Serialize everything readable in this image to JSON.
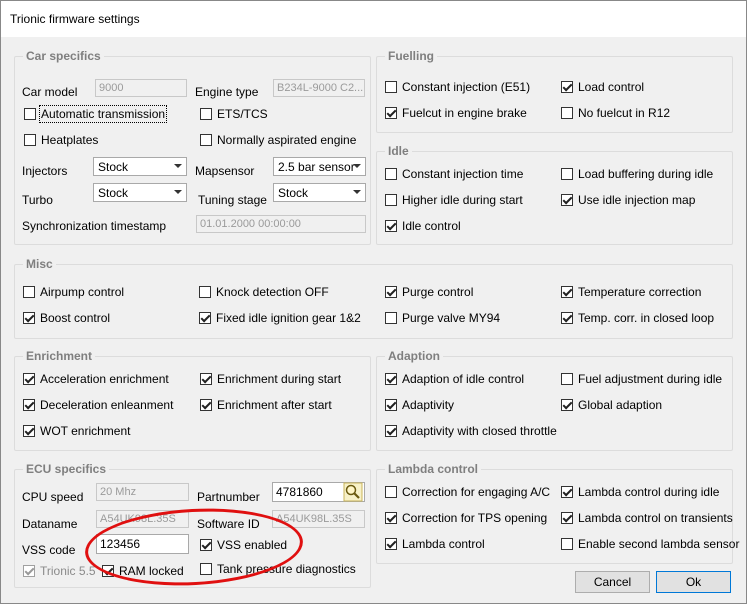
{
  "window": {
    "title": "Trionic firmware settings"
  },
  "car_specifics": {
    "legend": "Car specifics",
    "car_model_label": "Car model",
    "car_model_value": "9000",
    "engine_type_label": "Engine type",
    "engine_type_value": "B234L-9000 C2...",
    "automatic_transmission": {
      "label": "Automatic transmission",
      "checked": false
    },
    "ets_tcs": {
      "label": "ETS/TCS",
      "checked": false
    },
    "heatplates": {
      "label": "Heatplates",
      "checked": false
    },
    "normally_aspirated": {
      "label": "Normally aspirated engine",
      "checked": false
    },
    "injectors_label": "Injectors",
    "injectors_value": "Stock",
    "mapsensor_label": "Mapsensor",
    "mapsensor_value": "2.5 bar sensor",
    "turbo_label": "Turbo",
    "turbo_value": "Stock",
    "tuning_stage_label": "Tuning stage",
    "tuning_stage_value": "Stock",
    "sync_label": "Synchronization timestamp",
    "sync_value": "01.01.2000 00:00:00"
  },
  "fuelling": {
    "legend": "Fuelling",
    "constant_injection": {
      "label": "Constant injection (E51)",
      "checked": false
    },
    "load_control": {
      "label": "Load control",
      "checked": true
    },
    "fuelcut_engine_brake": {
      "label": "Fuelcut in engine brake",
      "checked": true
    },
    "no_fuelcut_r12": {
      "label": "No fuelcut in R12",
      "checked": false
    }
  },
  "idle": {
    "legend": "Idle",
    "constant_injection_time": {
      "label": "Constant injection time",
      "checked": false
    },
    "load_buffering_idle": {
      "label": "Load buffering during idle",
      "checked": false
    },
    "higher_idle_start": {
      "label": "Higher idle during start",
      "checked": false
    },
    "use_idle_injection_map": {
      "label": "Use idle injection map",
      "checked": true
    },
    "idle_control": {
      "label": "Idle control",
      "checked": true
    }
  },
  "misc": {
    "legend": "Misc",
    "airpump_control": {
      "label": "Airpump control",
      "checked": false
    },
    "knock_detection_off": {
      "label": "Knock detection OFF",
      "checked": false
    },
    "purge_control": {
      "label": "Purge control",
      "checked": true
    },
    "temperature_correction": {
      "label": "Temperature correction",
      "checked": true
    },
    "boost_control": {
      "label": "Boost control",
      "checked": true
    },
    "fixed_idle_ignition": {
      "label": "Fixed idle ignition gear 1&2",
      "checked": true
    },
    "purge_valve_my94": {
      "label": "Purge valve MY94",
      "checked": false
    },
    "temp_corr_closed_loop": {
      "label": "Temp. corr. in closed loop",
      "checked": true
    }
  },
  "enrichment": {
    "legend": "Enrichment",
    "acceleration_enrichment": {
      "label": "Acceleration enrichment",
      "checked": true
    },
    "enrichment_during_start": {
      "label": "Enrichment during start",
      "checked": true
    },
    "deceleration_enleanment": {
      "label": "Deceleration enleanment",
      "checked": true
    },
    "enrichment_after_start": {
      "label": "Enrichment after start",
      "checked": true
    },
    "wot_enrichment": {
      "label": "WOT enrichment",
      "checked": true
    }
  },
  "adaption": {
    "legend": "Adaption",
    "adaption_idle_control": {
      "label": "Adaption of idle control",
      "checked": true
    },
    "fuel_adjustment_idle": {
      "label": "Fuel adjustment during idle",
      "checked": false
    },
    "adaptivity": {
      "label": "Adaptivity",
      "checked": true
    },
    "global_adaption": {
      "label": "Global adaption",
      "checked": true
    },
    "adaptivity_closed_throttle": {
      "label": "Adaptivity with closed throttle",
      "checked": true
    }
  },
  "ecu_specifics": {
    "legend": "ECU specifics",
    "cpu_speed_label": "CPU speed",
    "cpu_speed_value": "20 Mhz",
    "partnumber_label": "Partnumber",
    "partnumber_value": "4781860",
    "dataname_label": "Dataname",
    "dataname_value": "A54UK98L.35S",
    "software_id_label": "Software ID",
    "software_id_value": "A54UK98L.35S",
    "vss_code_label": "VSS code",
    "vss_code_value": "123456",
    "vss_enabled": {
      "label": "VSS enabled",
      "checked": true
    },
    "trionic_55": {
      "label": "Trionic 5.5",
      "checked": true
    },
    "ram_locked": {
      "label": "RAM locked",
      "checked": true
    },
    "tank_pressure": {
      "label": "Tank pressure diagnostics",
      "checked": false
    }
  },
  "lambda_control": {
    "legend": "Lambda control",
    "correction_ac": {
      "label": "Correction for engaging A/C",
      "checked": false
    },
    "lambda_control_idle": {
      "label": "Lambda control during idle",
      "checked": true
    },
    "correction_tps": {
      "label": "Correction for TPS opening",
      "checked": true
    },
    "lambda_control_transients": {
      "label": "Lambda control on transients",
      "checked": true
    },
    "lambda_control": {
      "label": "Lambda control",
      "checked": true
    },
    "enable_second_sensor": {
      "label": "Enable second lambda sensor",
      "checked": false
    }
  },
  "buttons": {
    "cancel": "Cancel",
    "ok": "Ok"
  },
  "annotation": {
    "color": "#e01010"
  },
  "icons": {
    "search": "search-icon"
  }
}
